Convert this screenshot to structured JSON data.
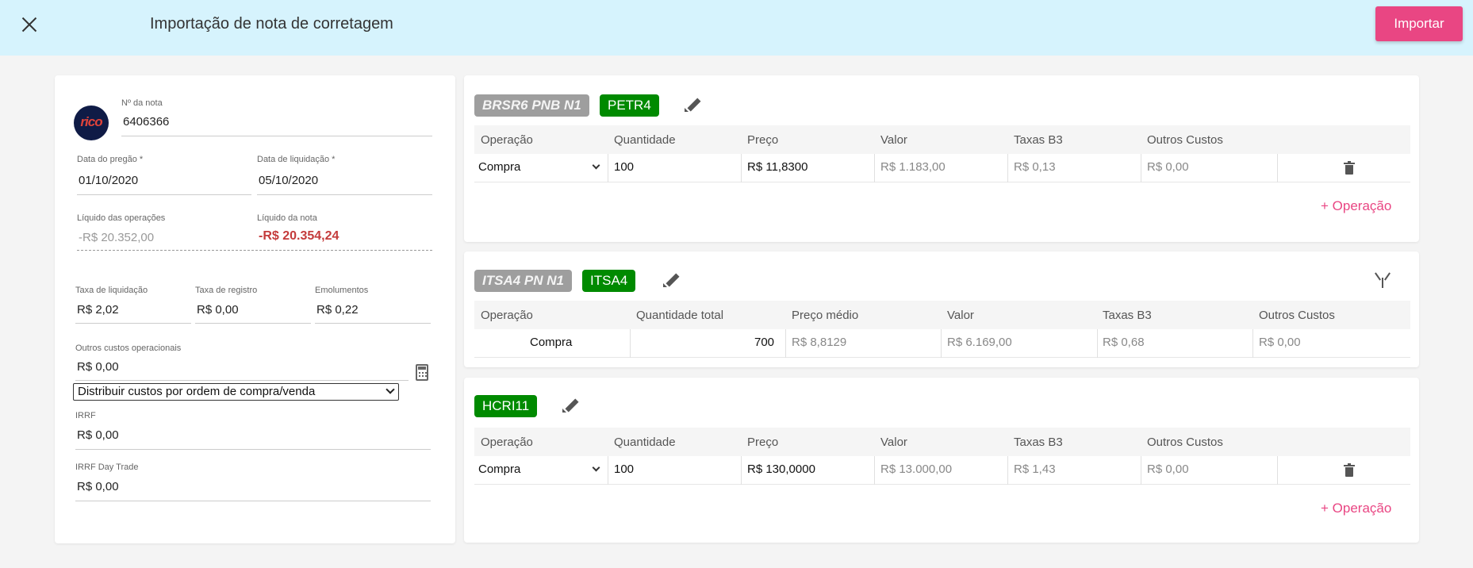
{
  "header": {
    "title": "Importação de nota de corretagem",
    "import_label": "Importar"
  },
  "note": {
    "logo_text": "rico",
    "number_label": "Nº da nota",
    "number": "6406366",
    "trade_date_label": "Data do pregão *",
    "trade_date": "01/10/2020",
    "settle_date_label": "Data de liquidação *",
    "settle_date": "05/10/2020",
    "net_ops_label": "Líquido das operações",
    "net_ops": "-R$ 20.352,00",
    "net_note_label": "Líquido da nota",
    "net_note": "-R$ 20.354,24",
    "settle_fee_label": "Taxa de liquidação",
    "settle_fee": "R$ 2,02",
    "reg_fee_label": "Taxa de registro",
    "reg_fee": "R$ 0,00",
    "emol_label": "Emolumentos",
    "emol": "R$ 0,22",
    "other_costs_label": "Outros custos operacionais",
    "other_costs": "R$ 0,00",
    "distribute_option": "Distribuir custos por ordem de compra/venda",
    "irrf_label": "IRRF",
    "irrf": "R$ 0,00",
    "irrf_dt_label": "IRRF Day Trade",
    "irrf_dt": "R$ 0,00"
  },
  "add_operation_label": "+ Operação",
  "assets": [
    {
      "original_tag": "BRSR6 PNB N1",
      "ticker": "PETR4",
      "columns": [
        "Operação",
        "Quantidade",
        "Preço",
        "Valor",
        "Taxas B3",
        "Outros Custos"
      ],
      "row": {
        "op": "Compra",
        "qty": "100",
        "price": "R$ 11,8300",
        "value": "R$ 1.183,00",
        "fees": "R$ 0,13",
        "other": "R$ 0,00"
      }
    },
    {
      "original_tag": "ITSA4 PN N1",
      "ticker": "ITSA4",
      "columns": [
        "Operação",
        "Quantidade total",
        "Preço médio",
        "Valor",
        "Taxas B3",
        "Outros Custos"
      ],
      "row": {
        "op": "Compra",
        "qty": "700",
        "price": "R$ 8,8129",
        "value": "R$ 6.169,00",
        "fees": "R$ 0,68",
        "other": "R$ 0,00"
      }
    },
    {
      "ticker": "HCRI11",
      "columns": [
        "Operação",
        "Quantidade",
        "Preço",
        "Valor",
        "Taxas B3",
        "Outros Custos"
      ],
      "row": {
        "op": "Compra",
        "qty": "100",
        "price": "R$ 130,0000",
        "value": "R$ 13.000,00",
        "fees": "R$ 1,43",
        "other": "R$ 0,00"
      }
    }
  ]
}
